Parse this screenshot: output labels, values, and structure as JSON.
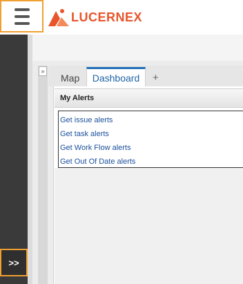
{
  "header": {
    "logo_text": "LUCERNEX",
    "brand_color": "#e8552b",
    "menu_icon": "hamburger-menu-icon"
  },
  "sidebar": {
    "expand_label": ">>",
    "highlight_color": "#f0a030"
  },
  "panel": {
    "collapse_label": "»"
  },
  "tabs": [
    {
      "label": "Map",
      "active": false
    },
    {
      "label": "Dashboard",
      "active": true
    },
    {
      "label": "+",
      "active": false
    }
  ],
  "alerts": {
    "title": "My Alerts",
    "links": [
      {
        "label": "Get issue alerts"
      },
      {
        "label": "Get task alerts"
      },
      {
        "label": "Get Work Flow alerts"
      },
      {
        "label": "Get Out Of Date alerts"
      }
    ],
    "link_color": "#1a4f9c"
  }
}
